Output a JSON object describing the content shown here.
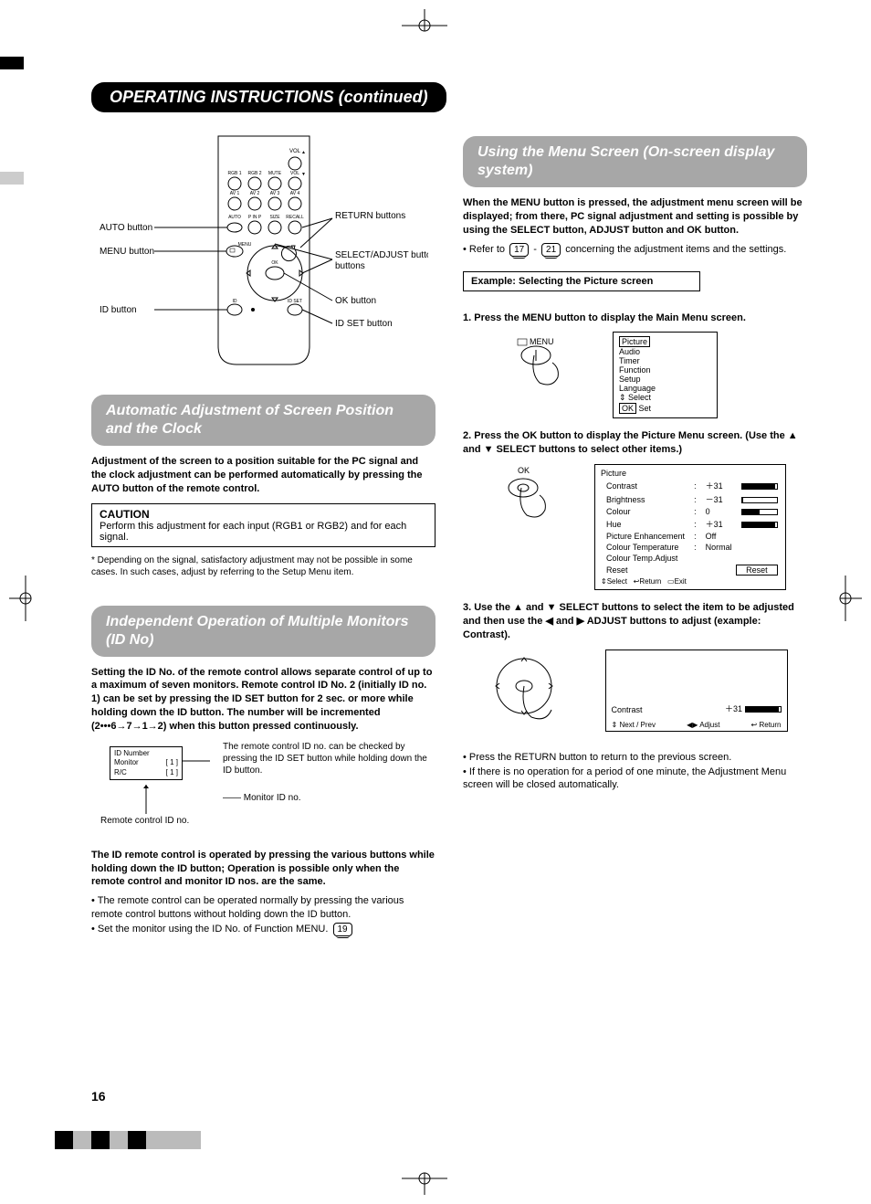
{
  "header": "OPERATING INSTRUCTIONS (continued)",
  "page_number": "16",
  "remote_labels": {
    "auto": "AUTO button",
    "menu": "MENU button",
    "id": "ID button",
    "return": "RETURN buttons",
    "select_adjust": "SELECT/ADJUST buttons",
    "ok": "OK button",
    "idset": "ID SET button",
    "vol_up": "VOL",
    "rgb1": "RGB 1",
    "rgb2": "RGB 2",
    "mute": "MUTE",
    "vol_dn": "VOL",
    "av1": "AV 1",
    "av2": "AV 2",
    "av3": "AV 3",
    "av4": "AV 4",
    "autobtn": "AUTO",
    "pinp": "P IN P",
    "size": "SIZE",
    "recall": "RECALL",
    "menubtn": "MENU",
    "okbtn": "OK",
    "idbtn": "ID",
    "idsetbtn": "ID SET"
  },
  "left": {
    "sec1_title": "Automatic Adjustment of Screen Position and the Clock",
    "sec1_body": "Adjustment of the screen to a position suitable for the PC signal and the clock adjustment can be performed automatically by pressing the AUTO button of the remote control.",
    "caution_title": "CAUTION",
    "caution_body": "Perform this adjustment for each input (RGB1 or RGB2) and for each signal.",
    "footnote": "* Depending on the signal, satisfactory adjustment may not be possible in some cases. In such cases, adjust by referring to the Setup Menu item.",
    "sec2_title": "Independent Operation of Multiple Monitors (ID No)",
    "sec2_body": "Setting the ID No. of the remote control allows separate control of up to a maximum of seven monitors. Remote control ID No. 2 (initially ID no. 1) can be set by pressing the ID SET button for 2 sec. or more while holding down the ID button.  The number will be incremented (2•••6→7→1→2) when this button pressed continuously.",
    "id_note": "The remote control ID no. can be checked by pressing the ID SET button while holding down the ID button.",
    "monitor_id_label": "Monitor ID no.",
    "remote_id_label": "Remote control ID no.",
    "id_box_l1": "ID Number",
    "id_box_l2": "Monitor",
    "id_box_l3": "R/C",
    "id_box_v": "[ 1 ]",
    "sec2_tail": "The ID remote control is operated by pressing the various buttons while holding down the ID button; Operation is possible only when the remote control and monitor ID nos. are the same.",
    "sec2_bullet1": "The remote control can be operated normally by pressing the various remote control buttons without holding down the ID button.",
    "sec2_bullet2": "Set the monitor using the ID No. of Function MENU.",
    "pageref19": "19"
  },
  "right": {
    "sec_title": "Using the Menu Screen  (On-screen display system)",
    "intro_bold": "When the MENU button is pressed, the adjustment menu screen will be displayed; from there, PC signal adjustment and setting is possible by using the SELECT button, ADJUST button and OK button.",
    "intro_bullet": "Refer to ",
    "intro_bullet_tail": " concerning the adjustment items and the settings.",
    "pageref17": "17",
    "pageref21": "21",
    "example_title": "Example: Selecting the Picture screen",
    "step1": "1. Press the MENU button to display the Main Menu screen.",
    "menu_label": "MENU",
    "ok_label": "OK",
    "main_menu": {
      "items": [
        "Picture",
        "Audio",
        "Timer",
        "Function",
        "Setup",
        "Language"
      ],
      "select_hint": "Select",
      "set_hint": "Set",
      "ok_box": "OK"
    },
    "step2": "2. Press the OK button to display the Picture Menu screen. (Use the ▲ and ▼ SELECT buttons to select other items.)",
    "picture_menu": {
      "title": "Picture",
      "rows": [
        {
          "k": "Contrast",
          "v": "＋31",
          "bar": 0.95
        },
        {
          "k": "Brightness",
          "v": "－31",
          "bar": 0.05
        },
        {
          "k": "Colour",
          "v": "0",
          "bar": 0.5
        },
        {
          "k": "Hue",
          "v": "＋31",
          "bar": 0.95
        },
        {
          "k": "Picture Enhancement",
          "v": "Off"
        },
        {
          "k": "Colour Temperature",
          "v": "Normal"
        },
        {
          "k": "Colour Temp.Adjust",
          "v": ""
        },
        {
          "k": "Reset",
          "v": ""
        }
      ],
      "reset": "Reset",
      "hint_select": "Select",
      "hint_return": "Return",
      "hint_exit": "Exit"
    },
    "step3": "3. Use the ▲ and ▼ SELECT buttons to select the item to be adjusted and then use the ◀ and ▶ ADJUST buttons to adjust (example: Contrast).",
    "adj_box": {
      "contrast": "Contrast",
      "value": "＋31",
      "next": "Next / Prev",
      "adjust": "Adjust",
      "return": "Return"
    },
    "tail_b1": "Press the RETURN button to return to the previous screen.",
    "tail_b2": "If there is no operation for a period of one minute, the Adjustment Menu screen will be closed automatically."
  }
}
